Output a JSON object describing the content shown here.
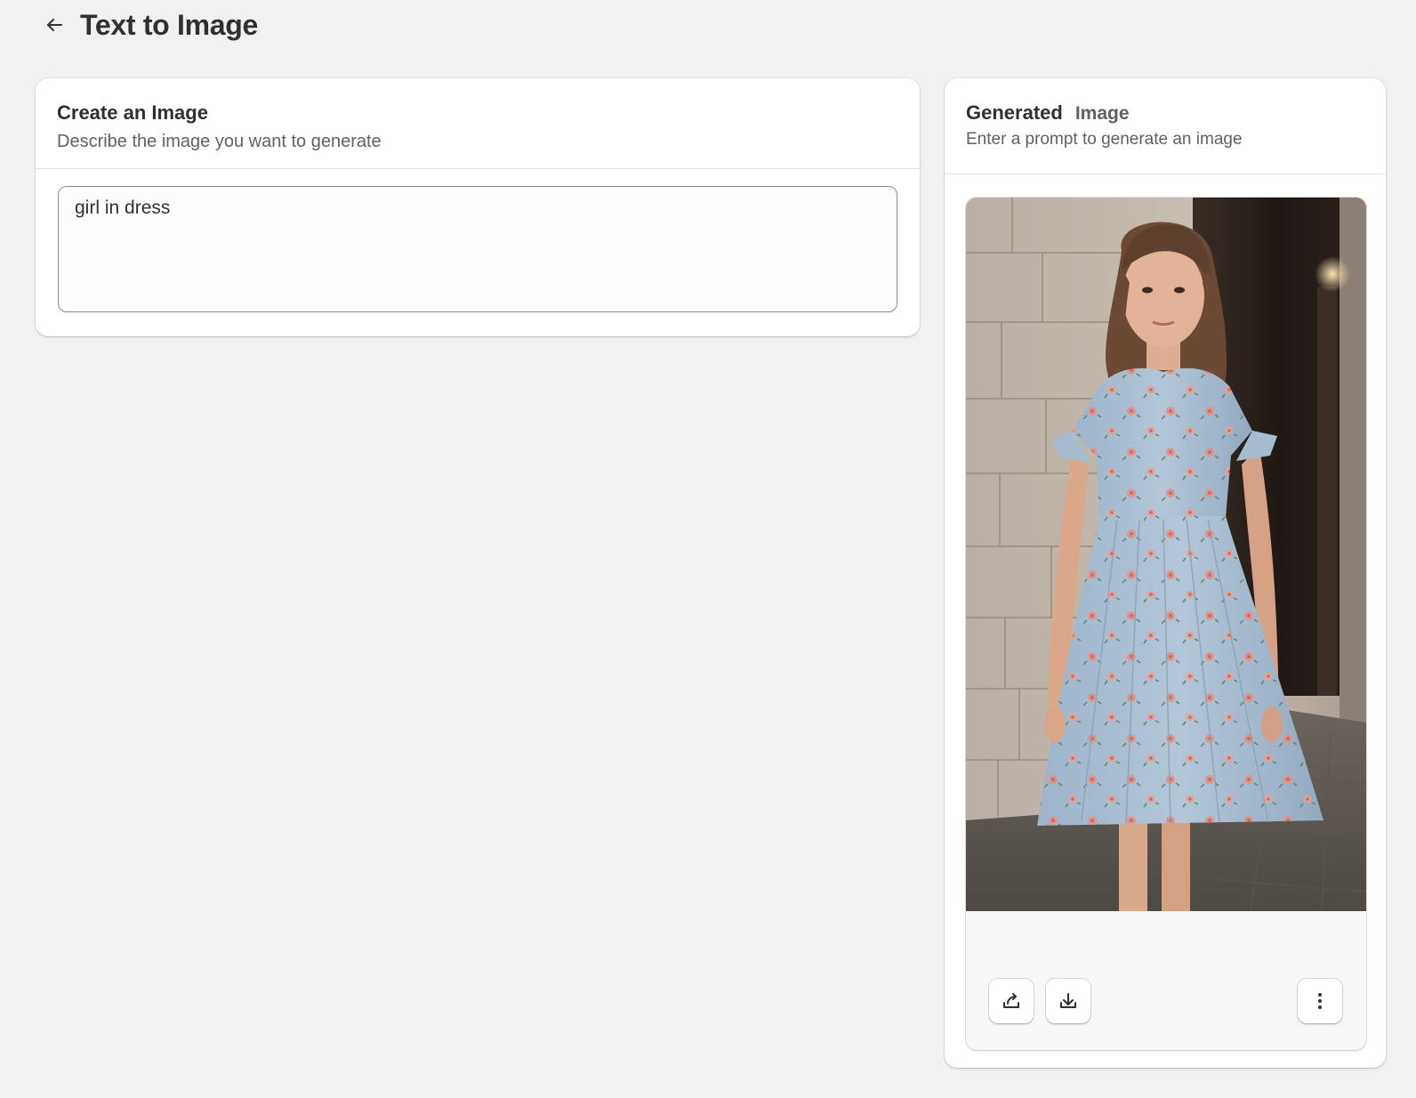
{
  "header": {
    "back_icon": "arrow-left-icon",
    "title": "Text to Image"
  },
  "create_card": {
    "title": "Create an Image",
    "subtitle": "Describe the image you want to generate",
    "prompt_value": "girl in dress"
  },
  "generated_card": {
    "title": "Generated",
    "title_secondary": "Image",
    "subtitle": "Enter a prompt to generate an image",
    "image_alt": "girl in dress",
    "actions": {
      "share_icon": "share-icon",
      "download_icon": "download-icon",
      "more_icon": "more-vertical-icon"
    }
  },
  "colors": {
    "background": "#f1f1f1",
    "card": "#ffffff",
    "text_primary": "#303030",
    "text_secondary": "#616161",
    "dress_blue": "#a9bfd3",
    "flower_pink": "#e58f84"
  }
}
